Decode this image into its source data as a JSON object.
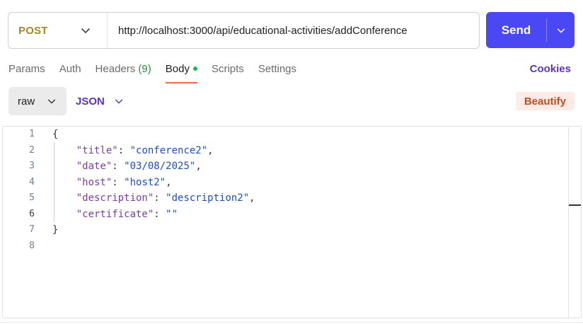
{
  "request": {
    "method": "POST",
    "url": "http://localhost:3000/api/educational-activities/addConference",
    "send_label": "Send"
  },
  "tabs": [
    {
      "label": "Params"
    },
    {
      "label": "Auth"
    },
    {
      "label": "Headers",
      "count": "(9)"
    },
    {
      "label": "Body",
      "active": true
    },
    {
      "label": "Scripts"
    },
    {
      "label": "Settings"
    }
  ],
  "cookies_label": "Cookies",
  "body": {
    "mode": "raw",
    "language": "JSON",
    "beautify_label": "Beautify"
  },
  "editor": {
    "line_numbers": [
      "1",
      "2",
      "3",
      "4",
      "5",
      "6",
      "7",
      "8"
    ],
    "lines": [
      {
        "punc_open": "{"
      },
      {
        "key": "\"title\"",
        "value": "\"conference2\"",
        "trail": ","
      },
      {
        "key": "\"date\"",
        "value": "\"03/08/2025\"",
        "trail": ","
      },
      {
        "key": "\"host\"",
        "value": "\"host2\"",
        "trail": ","
      },
      {
        "key": "\"description\"",
        "value": "\"description2\"",
        "trail": ","
      },
      {
        "key": "\"certificate\"",
        "value": "\"\"",
        "trail": ""
      },
      {
        "punc_close": "}"
      },
      {}
    ]
  },
  "colors": {
    "method": "#a8862b",
    "send_bg": "#4a47f5",
    "accent_purple": "#5b32c9",
    "active_tab_underline": "#f26b3a",
    "body_dot": "#1db954",
    "beautify_bg": "#fdebe6",
    "beautify_text": "#c34a1f",
    "json_key": "#7a3e9d",
    "json_string": "#1d4ebd"
  }
}
